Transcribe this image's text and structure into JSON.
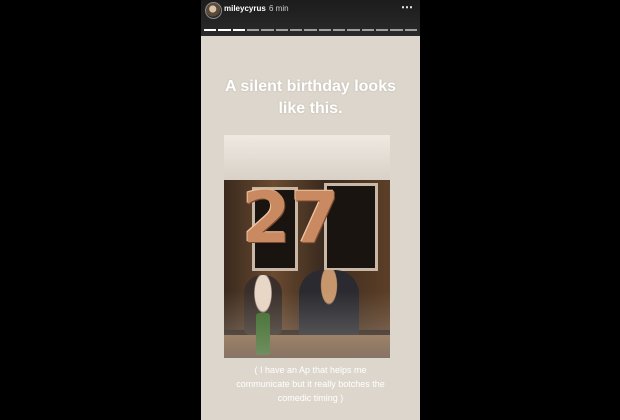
{
  "story": {
    "username": "mileycyrus",
    "time": "6 min",
    "more_icon": "⋯",
    "segments": 15,
    "active_segments": 3
  },
  "headline": {
    "line1": "A silent birthday looks",
    "line2": "like this."
  },
  "photo": {
    "balloon_text": "27"
  },
  "caption": {
    "line1": "( I have an Ap that helps me",
    "line2": "communicate but it really botches the",
    "line3": "comedic timing )"
  }
}
